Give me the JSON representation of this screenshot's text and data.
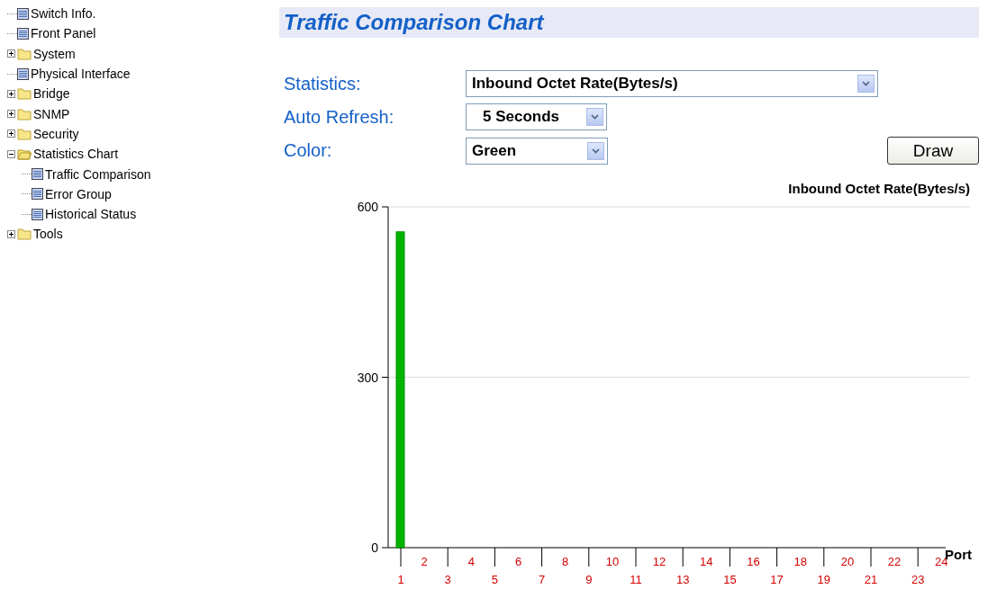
{
  "sidebar": {
    "items": [
      {
        "label": "Switch Info.",
        "kind": "page"
      },
      {
        "label": "Front Panel",
        "kind": "page"
      },
      {
        "label": "System",
        "kind": "folder",
        "expanded": false
      },
      {
        "label": "Physical Interface",
        "kind": "page"
      },
      {
        "label": "Bridge",
        "kind": "folder",
        "expanded": false
      },
      {
        "label": "SNMP",
        "kind": "folder",
        "expanded": false
      },
      {
        "label": "Security",
        "kind": "folder",
        "expanded": false
      },
      {
        "label": "Statistics Chart",
        "kind": "folder",
        "expanded": true,
        "children": [
          {
            "label": "Traffic Comparison",
            "kind": "page"
          },
          {
            "label": "Error Group",
            "kind": "page"
          },
          {
            "label": "Historical Status",
            "kind": "page"
          }
        ]
      },
      {
        "label": "Tools",
        "kind": "folder",
        "expanded": false
      }
    ]
  },
  "title": "Traffic Comparison Chart",
  "form": {
    "fields": [
      {
        "label": "Statistics:",
        "value": "Inbound Octet Rate(Bytes/s)"
      },
      {
        "label": "Auto Refresh:",
        "value": "5 Seconds"
      },
      {
        "label": "Color:",
        "value": "Green"
      }
    ],
    "button": "Draw"
  },
  "chart_data": {
    "type": "bar",
    "title": "Inbound Octet Rate(Bytes/s)",
    "xlabel": "Port",
    "categories": [
      "1",
      "2",
      "3",
      "4",
      "5",
      "6",
      "7",
      "8",
      "9",
      "10",
      "11",
      "12",
      "13",
      "14",
      "15",
      "16",
      "17",
      "18",
      "19",
      "20",
      "21",
      "22",
      "23",
      "24"
    ],
    "series": [
      {
        "color": "#00b400",
        "values": [
          556,
          0,
          0,
          0,
          0,
          0,
          0,
          0,
          0,
          0,
          0,
          0,
          0,
          0,
          0,
          0,
          0,
          0,
          0,
          0,
          0,
          0,
          0,
          0
        ]
      }
    ],
    "ylim": [
      0,
      600
    ],
    "yticks": [
      0,
      300,
      600
    ]
  }
}
